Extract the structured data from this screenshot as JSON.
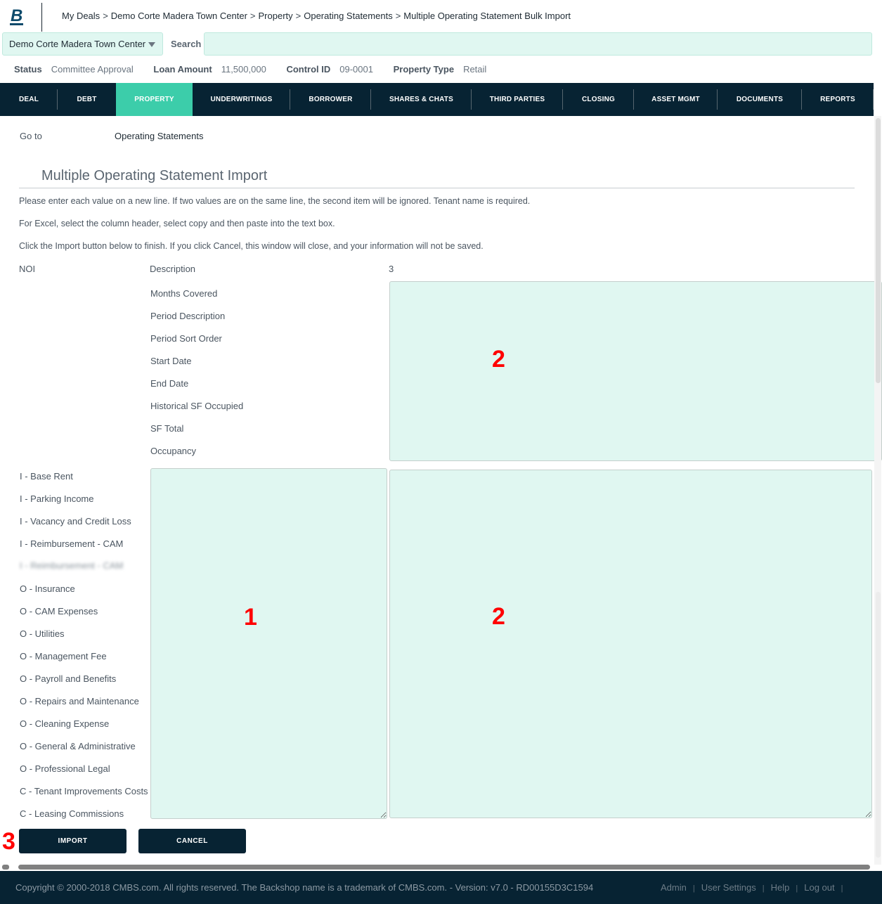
{
  "header": {
    "logo": "B",
    "breadcrumb": [
      "My Deals",
      "Demo Corte Madera Town Center",
      "Property",
      "Operating Statements",
      "Multiple Operating Statement Bulk Import"
    ],
    "breadcrumb_separator": ">"
  },
  "deal_selector": {
    "value": "Demo Corte Madera Town Center",
    "icon": "caret-down-icon"
  },
  "search": {
    "label": "Search",
    "value": "",
    "placeholder": ""
  },
  "status_bar": [
    {
      "label": "Status",
      "value": "Committee Approval"
    },
    {
      "label": "Loan Amount",
      "value": "11,500,000"
    },
    {
      "label": "Control ID",
      "value": "09-0001"
    },
    {
      "label": "Property Type",
      "value": "Retail"
    }
  ],
  "nav": {
    "active": "PROPERTY",
    "tabs": [
      "DEAL",
      "DEBT",
      "PROPERTY",
      "UNDERWRITINGS",
      "BORROWER",
      "SHARES & CHATS",
      "THIRD PARTIES",
      "CLOSING",
      "ASSET MGMT",
      "DOCUMENTS",
      "REPORTS"
    ]
  },
  "goto": {
    "label": "Go to",
    "link": "Operating Statements"
  },
  "page": {
    "title": "Multiple Operating Statement Import",
    "instructions": [
      "Please enter each value on a new line. If two values are on the same line, the second item will be ignored. Tenant name is required.",
      "For Excel, select the column header, select copy and then paste into the text box.",
      "Click the Import button below to finish. If you click Cancel, this window will close, and your information will not be saved."
    ]
  },
  "form": {
    "noi_label": "NOI",
    "description_label": "Description",
    "column_count": "3",
    "period_fields": [
      "Months Covered",
      "Period Description",
      "Period Sort Order",
      "Start Date",
      "End Date",
      "Historical SF Occupied",
      "SF Total",
      "Occupancy"
    ],
    "line_items": [
      "I - Base Rent",
      "I - Parking Income",
      "I - Vacancy and Credit Loss",
      "I - Reimbursement - CAM",
      "I - Reimbursement - CAM",
      "O - Insurance",
      "O - CAM Expenses",
      "O - Utilities",
      "O - Management Fee",
      "O - Payroll and Benefits",
      "O - Repairs and Maintenance",
      "O - Cleaning Expense",
      "O - General & Administrative",
      "O - Professional Legal",
      "C - Tenant Improvements Costs",
      "C - Leasing Commissions"
    ],
    "blurred_line_item_index": 4,
    "period_values_textarea": "",
    "description_textarea": "",
    "line_values_textarea": ""
  },
  "annotations": {
    "a1": "1",
    "a2_top": "2",
    "a2_bottom": "2",
    "a3": "3"
  },
  "buttons": {
    "import": "IMPORT",
    "cancel": "CANCEL"
  },
  "footer": {
    "copyright": "Copyright © 2000-2018 CMBS.com. All rights reserved. The Backshop name is a trademark of CMBS.com. - Version: v7.0 - RD00155D3C1594",
    "links": [
      "Admin",
      "User Settings",
      "Help",
      "Log out"
    ]
  }
}
